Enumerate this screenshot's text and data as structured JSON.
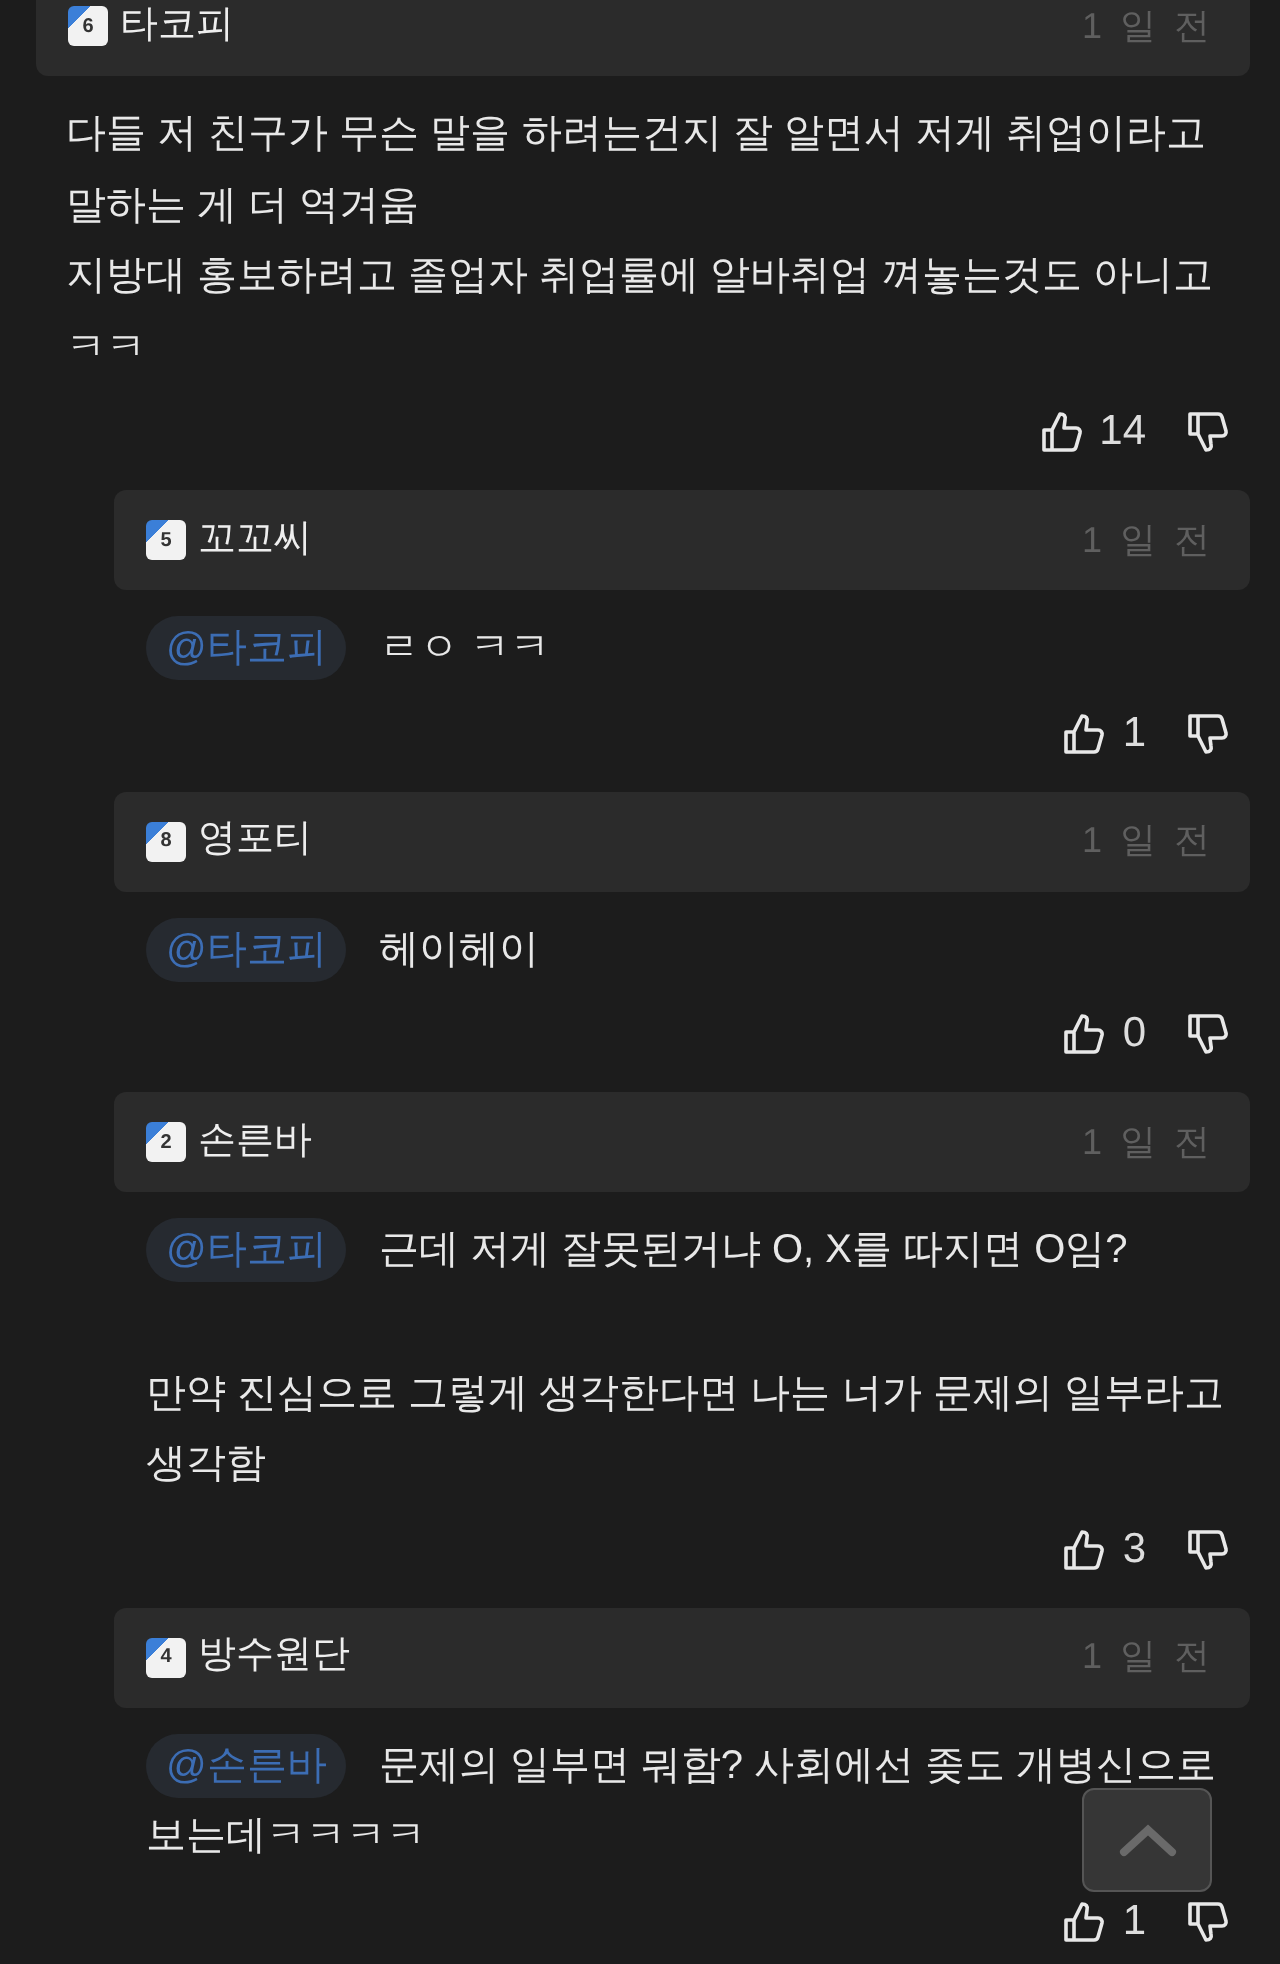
{
  "comments": [
    {
      "kind": "comment",
      "author": "타코피",
      "level": "6",
      "time": "1 일 전",
      "paragraphs": [
        [
          "다들 저 친구가 무슨 말을 하려는건지 잘 알면서 저게 취업이라고",
          "말하는 게 더 역겨움",
          "지방대 홍보하려고 졸업자 취업률에 알바취업 껴놓는것도 아니고",
          "ㅋㅋ"
        ]
      ],
      "likes": "14"
    },
    {
      "kind": "reply",
      "author": "꼬꼬씨",
      "level": "5",
      "time": "1 일 전",
      "mention": "@타코피",
      "paragraphs": [
        [
          "ㄹㅇ ㅋㅋ"
        ]
      ],
      "likes": "1"
    },
    {
      "kind": "reply",
      "author": "영포티",
      "level": "8",
      "time": "1 일 전",
      "mention": "@타코피",
      "paragraphs": [
        [
          "헤이헤이"
        ]
      ],
      "likes": "0"
    },
    {
      "kind": "reply",
      "author": "손른바",
      "level": "2",
      "time": "1 일 전",
      "mention": "@타코피",
      "paragraphs": [
        [
          "근데 저게 잘못된거냐 O, X를 따지면 O임?"
        ],
        [
          "만약 진심으로 그렇게 생각한다면 나는 너가 문제의 일부라고",
          "생각함"
        ]
      ],
      "likes": "3"
    },
    {
      "kind": "reply",
      "author": "방수원단",
      "level": "4",
      "time": "1 일 전",
      "mention": "@손른바",
      "paragraphs": [
        [
          "문제의 일부면 뭐함? 사회에선 좆도 개병신으로",
          "보는데ㅋㅋㅋㅋ"
        ]
      ],
      "likes": "1"
    }
  ]
}
